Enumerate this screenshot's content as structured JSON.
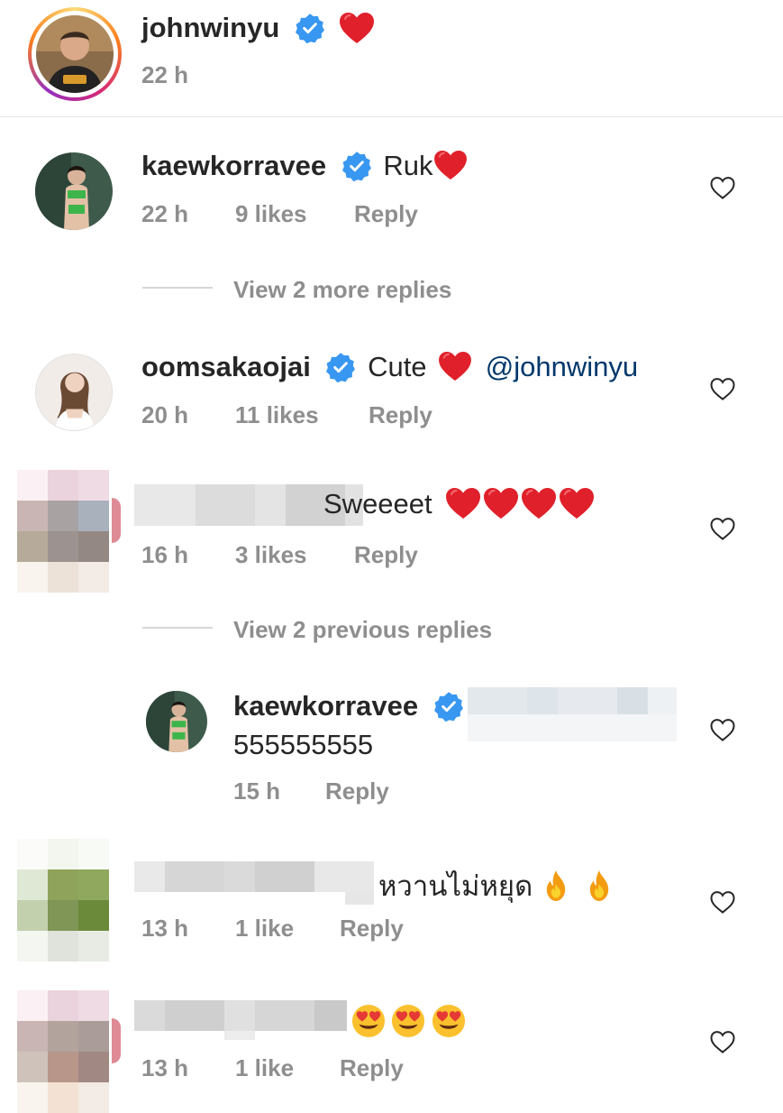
{
  "post": {
    "username": "johnwinyu",
    "emoji": "❤",
    "time": "22 h"
  },
  "comments": [
    {
      "username": "kaewkorravee",
      "text": "Ruk",
      "time": "22 h",
      "likes": "9 likes",
      "reply": "Reply",
      "view_more": "View 2 more replies"
    },
    {
      "username": "oomsakaojai",
      "text": "Cute",
      "mention": "@johnwinyu",
      "time": "20 h",
      "likes": "11 likes",
      "reply": "Reply"
    },
    {
      "text": "Sweeeet",
      "time": "16 h",
      "likes": "3 likes",
      "reply": "Reply",
      "view_more": "View 2 previous replies"
    },
    {
      "username": "kaewkorravee",
      "text": "555555555",
      "time": "15 h",
      "reply": "Reply"
    },
    {
      "text": "หวานไม่หยุด",
      "time": "13 h",
      "likes": "1 like",
      "reply": "Reply"
    },
    {
      "time": "13 h",
      "likes": "1 like",
      "reply": "Reply"
    }
  ],
  "icons": {
    "verified": "verified-badge-icon",
    "heart": "heart-icon",
    "like": "heart-outline-icon",
    "fire": "fire-emoji",
    "heart_eyes": "heart-eyes-emoji"
  },
  "colors": {
    "verified": "#3897f0",
    "heart": "#ed1c24",
    "meta": "#8e8e8e",
    "mention": "#00376b"
  }
}
